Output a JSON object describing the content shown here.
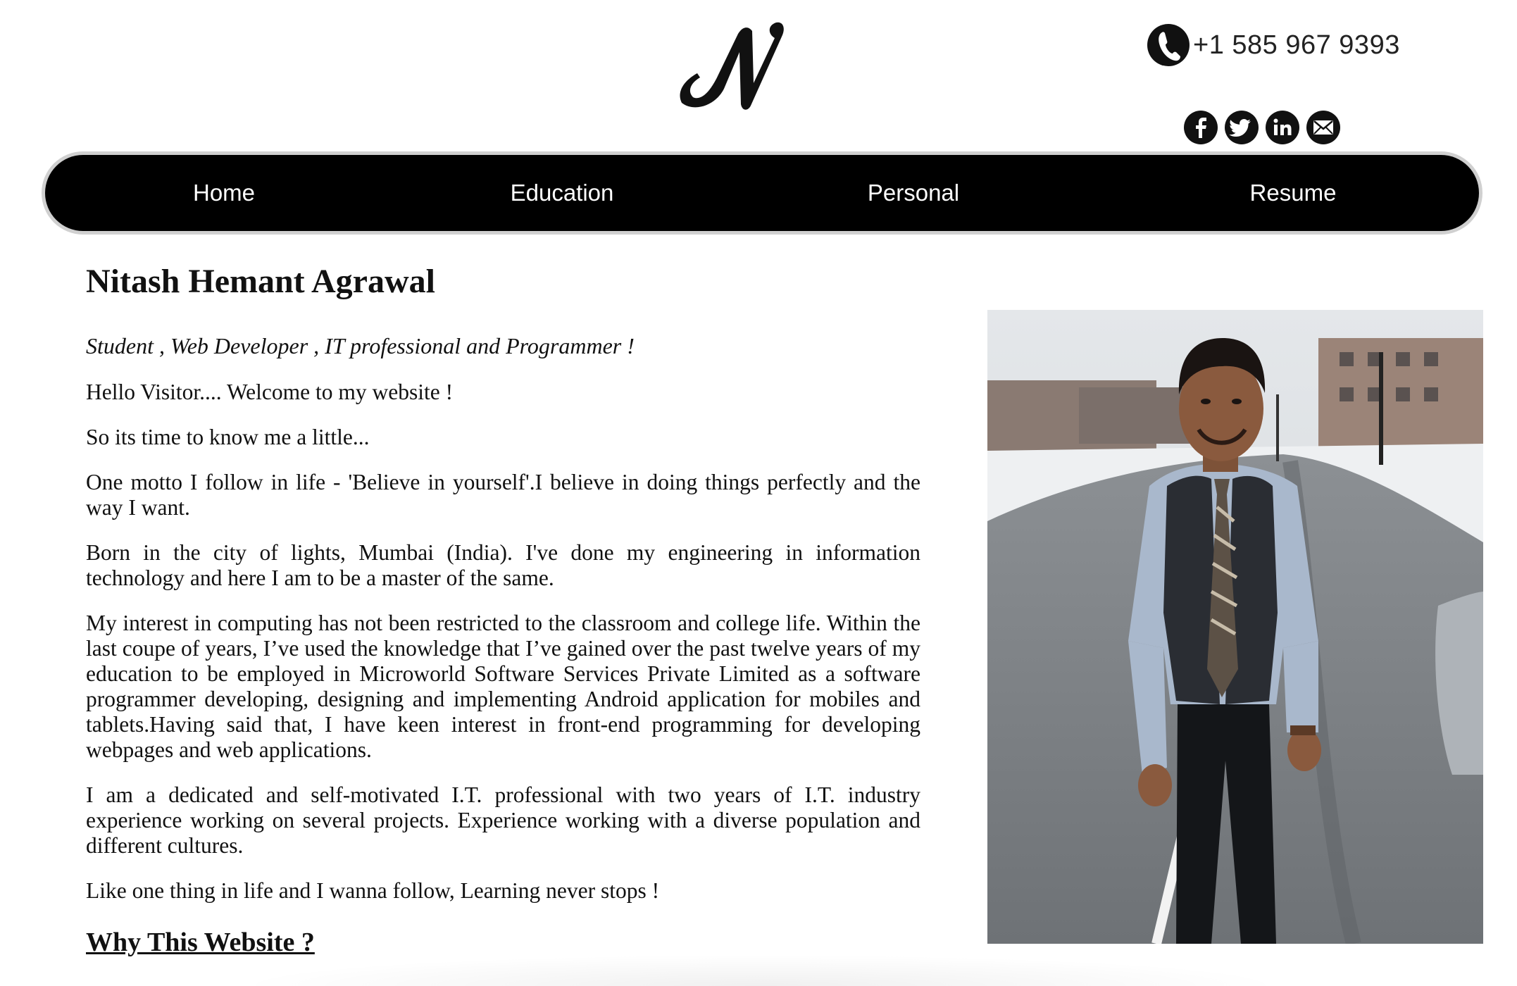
{
  "header": {
    "logo_alt": "N",
    "phone": "+1 585 967 9393",
    "social": [
      {
        "name": "facebook",
        "icon": "facebook-icon",
        "glyph": "f"
      },
      {
        "name": "twitter",
        "icon": "twitter-icon",
        "glyph": ""
      },
      {
        "name": "linkedin",
        "icon": "linkedin-icon",
        "glyph": "in"
      },
      {
        "name": "email",
        "icon": "mail-icon",
        "glyph": ""
      }
    ]
  },
  "nav": {
    "items": [
      {
        "label": "Home"
      },
      {
        "label": "Education"
      },
      {
        "label": "Personal"
      },
      {
        "label": "Resume"
      }
    ]
  },
  "main": {
    "name": "Nitash Hemant Agrawal",
    "tagline": "Student , Web Developer , IT professional and Programmer !",
    "paragraphs": [
      "Hello Visitor.... Welcome to my website !",
      "So its time to know me a little...",
      "One motto I follow in life - 'Believe in yourself'.I believe in doing things perfectly and the way I want.",
      "Born in the city of lights, Mumbai (India). I've done my engineering in information technology and here I am to be a master of the same.",
      "My interest in computing has not been restricted to the classroom and college life. Within the last coupe of years, I’ve used the knowledge that I’ve gained over the past twelve years of my education to be employed in Microworld Software Services Private Limited as a software programmer developing, designing and implementing Android application for mobiles and tablets.Having said that, I have keen interest in front-end programming for developing webpages and web applications.",
      "I am a dedicated and self-motivated I.T. professional with two years of I.T. industry experience working on several projects. Experience working with a diverse population and different cultures.",
      "Like one thing in life and I wanna follow, Learning never stops !"
    ],
    "section_heading": "Why This Website ?"
  },
  "colors": {
    "nav_background": "#000000",
    "nav_border": "#d0d0d0",
    "nav_text": "#ffffff",
    "page_background": "#ffffff"
  }
}
